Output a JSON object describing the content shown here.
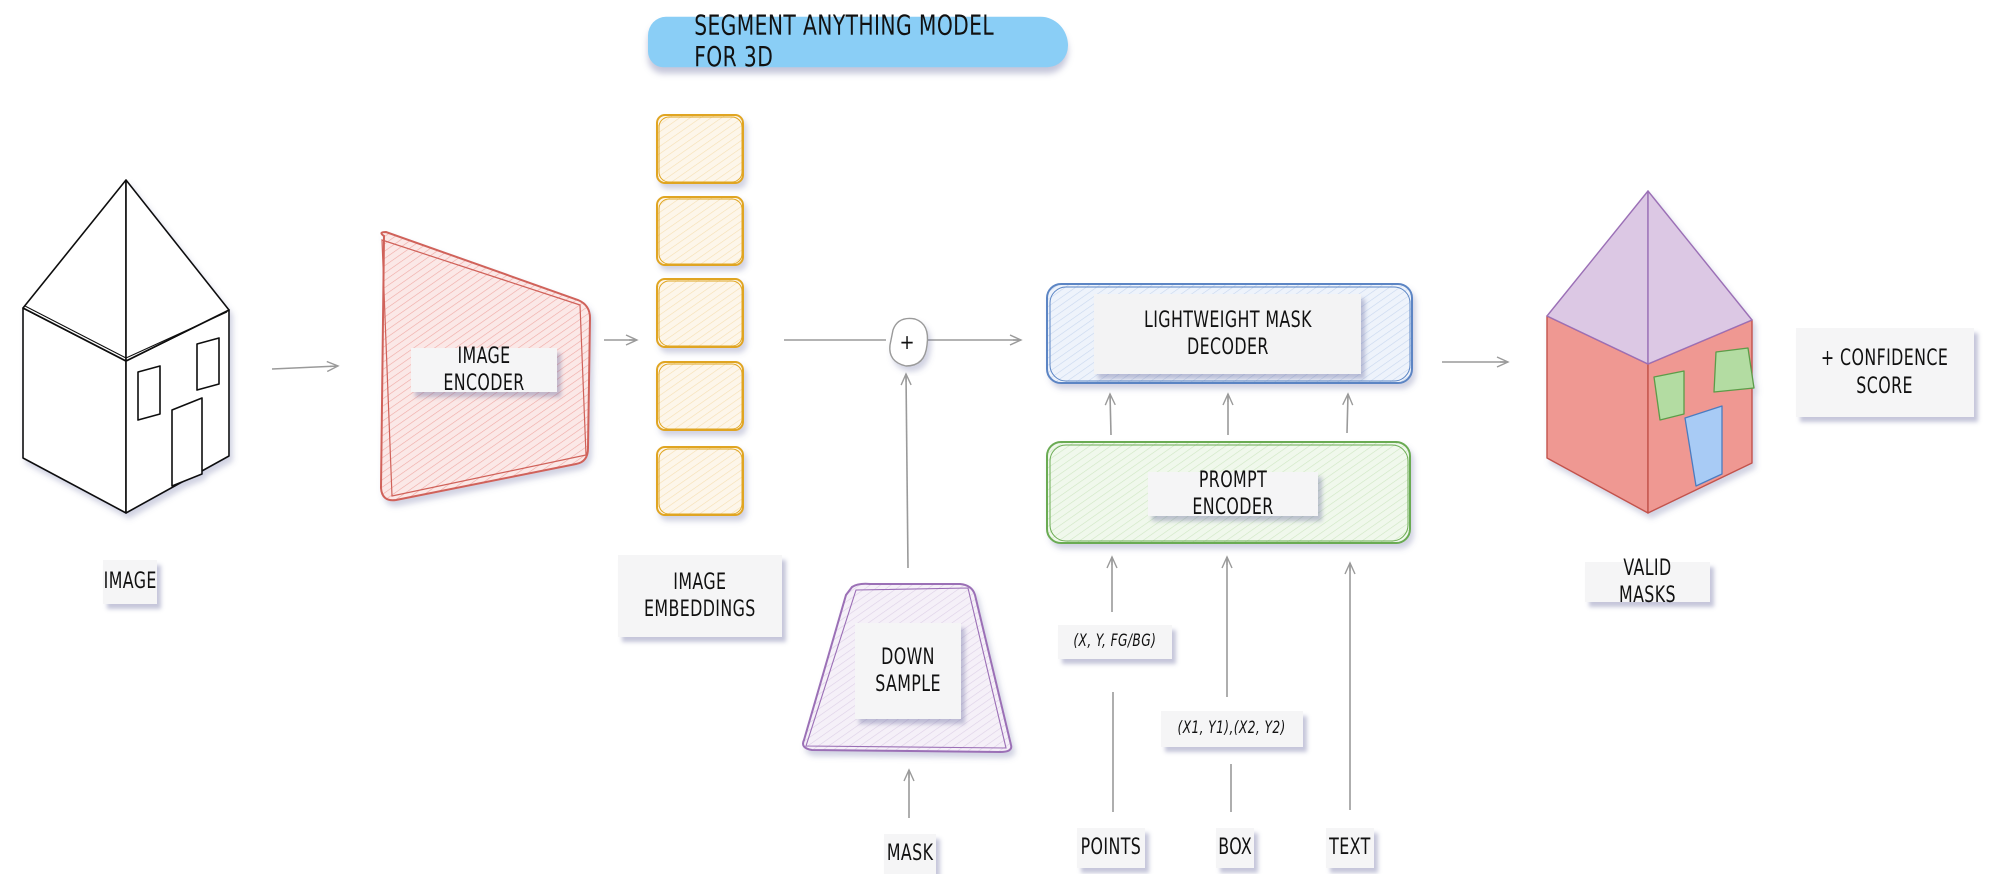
{
  "title": "SEGMENT ANYTHING MODEL FOR 3D",
  "colors": {
    "title_bg": "#8acef6",
    "image_encoder": "#d0625a",
    "embeddings": "#e0a520",
    "decoder": "#5b85c4",
    "prompt_encoder": "#6aab52",
    "downsample": "#9b6fb6",
    "mask_roof": "#dcc8e4",
    "mask_body": "#ef9892",
    "mask_windows": "#b3dca2",
    "mask_door": "#a8cbf5",
    "arrow": "#9a9a9a"
  },
  "nodes": {
    "input_image": {
      "label": "IMAGE"
    },
    "image_encoder": {
      "label": "IMAGE ENCODER"
    },
    "image_embeddings": {
      "label": "IMAGE\nEMBEDDINGS",
      "count": 5
    },
    "sum": {
      "symbol": "+"
    },
    "down_sample": {
      "label": "DOWN\nSAMPLE"
    },
    "mask_input": {
      "label": "MASK"
    },
    "mask_decoder": {
      "label": "LIGHTWEIGHT MASK\nDECODER"
    },
    "prompt_encoder": {
      "label": "PROMPT ENCODER"
    },
    "points_input": {
      "label": "POINTS",
      "format": "(X, Y, FG/BG)"
    },
    "box_input": {
      "label": "BOX",
      "format": "(X1, Y1),(X2, Y2)"
    },
    "text_input": {
      "label": "TEXT"
    },
    "output_masks": {
      "label": "VALID MASKS"
    },
    "confidence": {
      "label": "+ CONFIDENCE\nSCORE"
    }
  }
}
